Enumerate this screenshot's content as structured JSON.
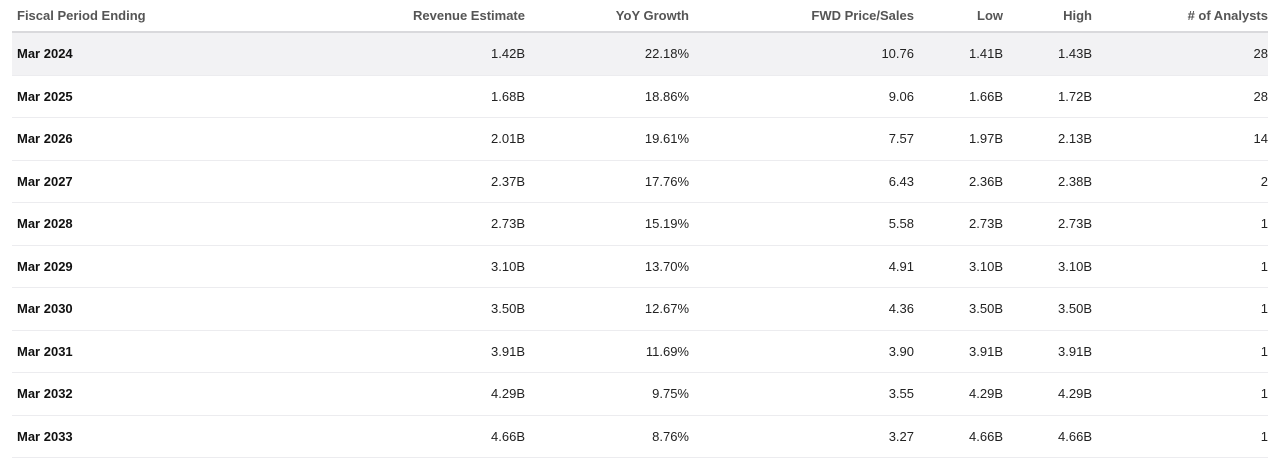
{
  "headers": [
    "Fiscal Period Ending",
    "Revenue Estimate",
    "YoY Growth",
    "FWD Price/Sales",
    "Low",
    "High",
    "# of Analysts"
  ],
  "rows": [
    [
      "Mar 2024",
      "1.42B",
      "22.18%",
      "10.76",
      "1.41B",
      "1.43B",
      "28"
    ],
    [
      "Mar 2025",
      "1.68B",
      "18.86%",
      "9.06",
      "1.66B",
      "1.72B",
      "28"
    ],
    [
      "Mar 2026",
      "2.01B",
      "19.61%",
      "7.57",
      "1.97B",
      "2.13B",
      "14"
    ],
    [
      "Mar 2027",
      "2.37B",
      "17.76%",
      "6.43",
      "2.36B",
      "2.38B",
      "2"
    ],
    [
      "Mar 2028",
      "2.73B",
      "15.19%",
      "5.58",
      "2.73B",
      "2.73B",
      "1"
    ],
    [
      "Mar 2029",
      "3.10B",
      "13.70%",
      "4.91",
      "3.10B",
      "3.10B",
      "1"
    ],
    [
      "Mar 2030",
      "3.50B",
      "12.67%",
      "4.36",
      "3.50B",
      "3.50B",
      "1"
    ],
    [
      "Mar 2031",
      "3.91B",
      "11.69%",
      "3.90",
      "3.91B",
      "3.91B",
      "1"
    ],
    [
      "Mar 2032",
      "4.29B",
      "9.75%",
      "3.55",
      "4.29B",
      "4.29B",
      "1"
    ],
    [
      "Mar 2033",
      "4.66B",
      "8.76%",
      "3.27",
      "4.66B",
      "4.66B",
      "1"
    ]
  ],
  "highlighted_row": 0
}
